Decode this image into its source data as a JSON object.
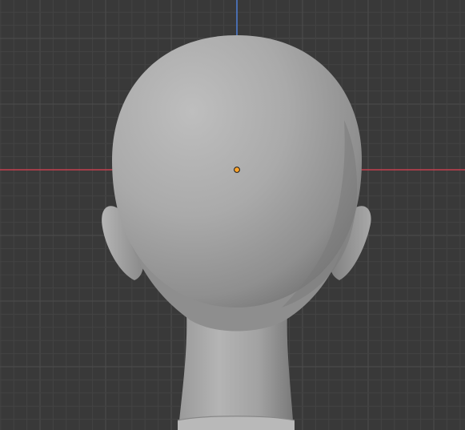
{
  "viewport": {
    "background": "#393939",
    "grid_minor_color": "#434343",
    "grid_major_color": "#4d4d4d",
    "x_axis_color": "#c4414f",
    "z_axis_color": "#4f7fd6",
    "origin_color": "#ffa42b"
  },
  "model": {
    "name_icon": "head-mesh",
    "skin_color": "#a9a9a9",
    "shade_color": "#7d7d7d"
  }
}
